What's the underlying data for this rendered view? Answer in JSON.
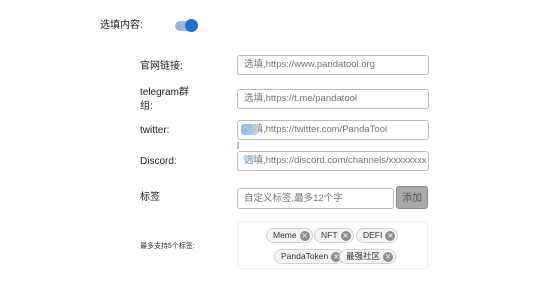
{
  "optional_label": "选填内容:",
  "toggle_on": true,
  "fields": [
    {
      "label": "官网链接:",
      "placeholder": "选填,https://www.pandatool.org"
    },
    {
      "label": "telegram群组:",
      "placeholder": "选填,https://t.me/pandatool"
    },
    {
      "label": "twitter:",
      "placeholder": "选填,https://twitter.com/PandaTool"
    },
    {
      "label": "Discord:",
      "placeholder": "选填,https://discord.com/channels/xxxxxxxx"
    }
  ],
  "tags_label": "标签",
  "tag_input_placeholder": "自定义标签,最多12个字",
  "add_button": "添加",
  "tags_limit_label": "最多支持5个标签:",
  "tags": [
    "Meme",
    "NFT",
    "DEFI",
    "PandaToken",
    "最强社区"
  ],
  "colors": {
    "toggle_accent": "#1e6fd9",
    "add_button_bg": "#a9a9a9"
  }
}
